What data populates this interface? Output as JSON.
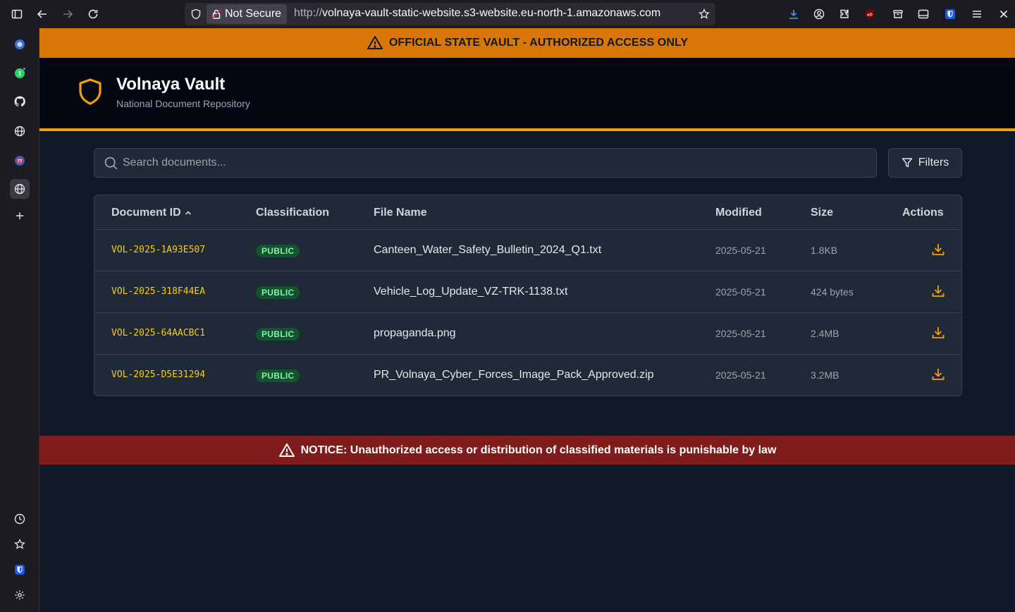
{
  "browser": {
    "url_status": "Not Secure",
    "url_scheme": "http://",
    "url_rest": "volnaya-vault-static-website.s3-website.eu-north-1.amazonaws.com"
  },
  "sidebar": {
    "icons": [
      "app-icon",
      "whatsapp-icon",
      "github-icon",
      "globe-icon",
      "app-badge-icon",
      "globe-icon",
      "plus-icon",
      "history-icon",
      "star-icon",
      "bitwarden-icon",
      "settings-icon"
    ],
    "whatsapp_badge": "1"
  },
  "banner": {
    "text": "OFFICIAL STATE VAULT - AUTHORIZED ACCESS ONLY",
    "color": "#d97706"
  },
  "header": {
    "title": "Volnaya Vault",
    "subtitle": "National Document Repository",
    "accent": "#f59e0b"
  },
  "search": {
    "placeholder": "Search documents...",
    "value": ""
  },
  "filters": {
    "label": "Filters"
  },
  "table": {
    "columns": [
      "Document ID",
      "Classification",
      "File Name",
      "Modified",
      "Size",
      "Actions"
    ],
    "sort_column": "Document ID",
    "sort_direction": "ascending",
    "rows": [
      {
        "id": "VOL-2025-1A93E507",
        "classification": "PUBLIC",
        "file_name": "Canteen_Water_Safety_Bulletin_2024_Q1.txt",
        "modified": "2025-05-21",
        "size": "1.8KB"
      },
      {
        "id": "VOL-2025-318F44EA",
        "classification": "PUBLIC",
        "file_name": "Vehicle_Log_Update_VZ-TRK-1138.txt",
        "modified": "2025-05-21",
        "size": "424 bytes"
      },
      {
        "id": "VOL-2025-64AACBC1",
        "classification": "PUBLIC",
        "file_name": "propaganda.png",
        "modified": "2025-05-21",
        "size": "2.4MB"
      },
      {
        "id": "VOL-2025-D5E31294",
        "classification": "PUBLIC",
        "file_name": "PR_Volnaya_Cyber_Forces_Image_Pack_Approved.zip",
        "modified": "2025-05-21",
        "size": "3.2MB"
      }
    ]
  },
  "notice": {
    "text": "NOTICE: Unauthorized access or distribution of classified materials is punishable by law",
    "color": "#7f1d1d"
  }
}
